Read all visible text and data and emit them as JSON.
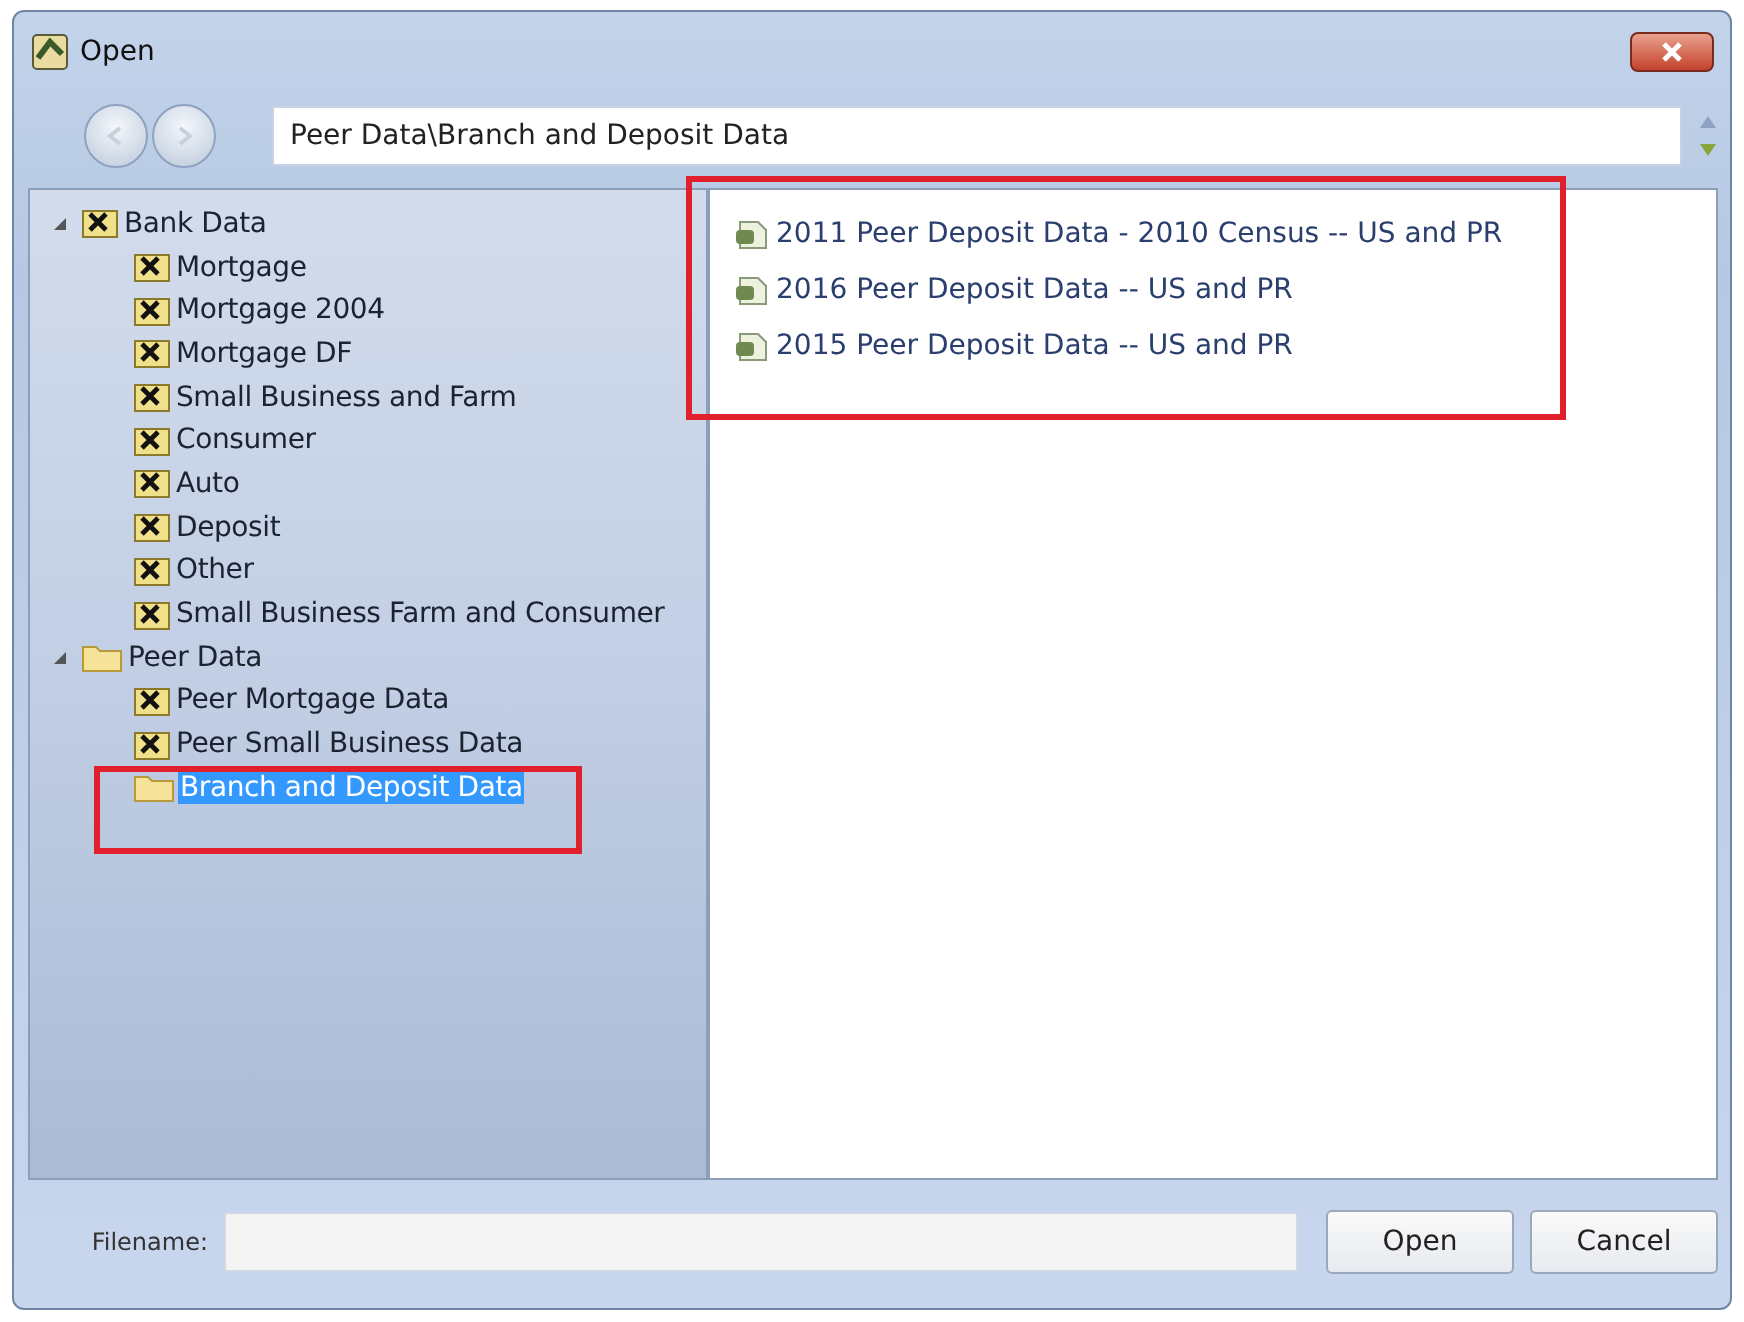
{
  "window": {
    "title": "Open"
  },
  "path_field": {
    "value": "Peer Data\\Branch and Deposit Data"
  },
  "tree": [
    {
      "label": "Bank Data",
      "kind": "dataset",
      "expanded": true,
      "selected": false,
      "children": [
        {
          "label": "Mortgage",
          "kind": "dataset",
          "selected": false
        },
        {
          "label": "Mortgage 2004",
          "kind": "dataset",
          "selected": false
        },
        {
          "label": "Mortgage DF",
          "kind": "dataset",
          "selected": false
        },
        {
          "label": "Small Business and Farm",
          "kind": "dataset",
          "selected": false
        },
        {
          "label": "Consumer",
          "kind": "dataset",
          "selected": false
        },
        {
          "label": "Auto",
          "kind": "dataset",
          "selected": false
        },
        {
          "label": "Deposit",
          "kind": "dataset",
          "selected": false
        },
        {
          "label": "Other",
          "kind": "dataset",
          "selected": false
        },
        {
          "label": "Small Business Farm and Consumer",
          "kind": "dataset",
          "selected": false
        }
      ]
    },
    {
      "label": "Peer Data",
      "kind": "folder",
      "expanded": true,
      "selected": false,
      "children": [
        {
          "label": "Peer Mortgage Data",
          "kind": "dataset",
          "selected": false
        },
        {
          "label": "Peer Small Business Data",
          "kind": "dataset",
          "selected": false
        },
        {
          "label": "Branch and Deposit Data",
          "kind": "folder",
          "selected": true
        }
      ]
    }
  ],
  "files": [
    {
      "name": "2011 Peer Deposit Data - 2010 Census -- US and PR"
    },
    {
      "name": "2016 Peer Deposit Data -- US and PR"
    },
    {
      "name": "2015 Peer Deposit Data -- US and PR"
    }
  ],
  "filename": {
    "label": "Filename:"
  },
  "buttons": [
    "Open",
    "Cancel"
  ]
}
